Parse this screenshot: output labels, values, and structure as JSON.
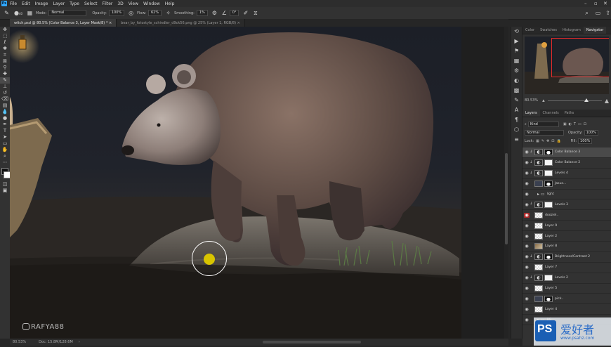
{
  "menu": {
    "items": [
      "File",
      "Edit",
      "Image",
      "Layer",
      "Type",
      "Select",
      "Filter",
      "3D",
      "View",
      "Window",
      "Help"
    ]
  },
  "options": {
    "brush_size": "40",
    "mode_label": "Mode:",
    "mode_value": "Normal",
    "opacity_label": "Opacity:",
    "opacity_value": "100%",
    "flow_label": "Flow:",
    "flow_value": "62%",
    "smoothing_label": "Smoothing:",
    "smoothing_value": "1%",
    "angle_value": "0°"
  },
  "tabs": [
    {
      "label": "witch.psd @ 80.5% (Color Balance 3, Layer Mask/8) *",
      "active": true
    },
    {
      "label": "bear_by_fotostyle_schindler_d9ck56.png @ 25% (Layer 1, RGB/8)",
      "active": false
    }
  ],
  "status": {
    "zoom": "80.53%",
    "doc": "Doc: 15.8M/128.6M"
  },
  "watermark": "RAFYA88",
  "navigator": {
    "tabs": [
      "Color",
      "Swatches",
      "Histogram",
      "Navigator"
    ],
    "active_tab": "Navigator",
    "zoom": "80.53%"
  },
  "layers_panel": {
    "tabs": [
      "Layers",
      "Channels",
      "Paths"
    ],
    "active_tab": "Layers",
    "filter_label": "Kind",
    "blend_mode": "Normal",
    "opacity_label": "Opacity:",
    "opacity_value": "100%",
    "lock_label": "Lock:",
    "fill_label": "Fill:",
    "fill_value": "100%",
    "layers": [
      {
        "name": "Color Balance 3",
        "thumb": "adj",
        "mask": "shape",
        "selected": true,
        "eye": "normal",
        "clip": true
      },
      {
        "name": "Color Balance 2",
        "thumb": "adj",
        "mask": "white",
        "selected": false,
        "eye": "normal",
        "clip": true
      },
      {
        "name": "Levels 4",
        "thumb": "adj",
        "mask": "white",
        "selected": false,
        "eye": "normal",
        "clip": true
      },
      {
        "name": "Jasus...",
        "thumb": "dark",
        "mask": "shape",
        "selected": false,
        "eye": "normal",
        "clip": false
      },
      {
        "name": "light",
        "thumb": "folder",
        "mask": "",
        "selected": false,
        "eye": "normal",
        "clip": false
      },
      {
        "name": "Levels 3",
        "thumb": "adj",
        "mask": "white",
        "selected": false,
        "eye": "normal",
        "clip": true
      },
      {
        "name": "dooziel..",
        "thumb": "ck",
        "mask": "",
        "selected": false,
        "eye": "red",
        "clip": false
      },
      {
        "name": "Layer 9",
        "thumb": "ck",
        "mask": "",
        "selected": false,
        "eye": "normal",
        "clip": false
      },
      {
        "name": "Layer 2",
        "thumb": "ck",
        "mask": "",
        "selected": false,
        "eye": "normal",
        "clip": false
      },
      {
        "name": "Layer 8",
        "thumb": "ph",
        "mask": "",
        "selected": false,
        "eye": "normal",
        "clip": false
      },
      {
        "name": "Brightness/Contrast 2",
        "thumb": "adj",
        "mask": "shape",
        "selected": false,
        "eye": "normal",
        "clip": true
      },
      {
        "name": "Layer 7",
        "thumb": "ck",
        "mask": "",
        "selected": false,
        "eye": "normal",
        "clip": false
      },
      {
        "name": "Levels 2",
        "thumb": "adj",
        "mask": "white",
        "selected": false,
        "eye": "normal",
        "clip": true
      },
      {
        "name": "Layer 5",
        "thumb": "ck",
        "mask": "",
        "selected": false,
        "eye": "normal",
        "clip": false
      },
      {
        "name": "pick..",
        "thumb": "dark",
        "mask": "shape",
        "selected": false,
        "eye": "normal",
        "clip": false
      },
      {
        "name": "Layer 4",
        "thumb": "ck",
        "mask": "",
        "selected": false,
        "eye": "normal",
        "clip": false
      },
      {
        "name": "BG",
        "thumb": "folder",
        "mask": "",
        "selected": false,
        "eye": "normal",
        "clip": false
      }
    ]
  },
  "logo": {
    "mark": "PS",
    "cn_text": "爱好者",
    "url": "www.psahz.com"
  }
}
